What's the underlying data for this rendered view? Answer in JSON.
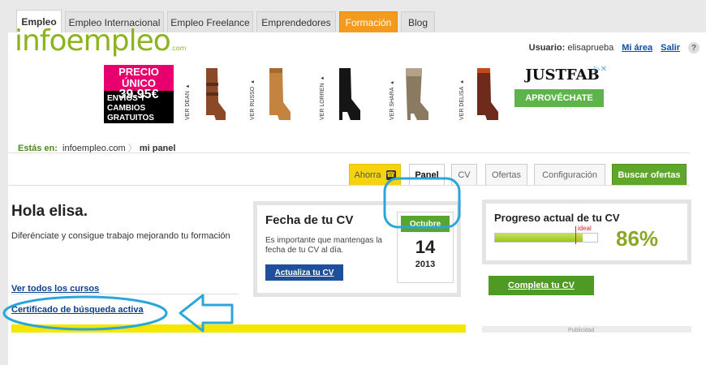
{
  "top_tabs": [
    {
      "label": "Empleo"
    },
    {
      "label": "Empleo Internacional"
    },
    {
      "label": "Empleo Freelance"
    },
    {
      "label": "Emprendedores"
    },
    {
      "label": "Formación"
    },
    {
      "label": "Blog"
    }
  ],
  "logo": {
    "text": "infoempleo",
    "suffix": ".com"
  },
  "user": {
    "label": "Usuario:",
    "name": "elisaprueba",
    "mi_area": "Mi área",
    "salir": "Salir",
    "help": "?"
  },
  "banner": {
    "promo_price_line1": "PRECIO ÚNICO",
    "promo_price_line2": "39.95€",
    "promo_shipping": "ENVÍOS Y CAMBIOS GRATUITOS",
    "boots": [
      "VER DEAN ▸",
      "VER RUSSO ▸",
      "VER LORREN ▸",
      "VER SHARA ▸",
      "VER DELISA ▸"
    ],
    "brand": "JUSTFAB",
    "cta": "APROVÉCHATE",
    "ad_marks": "▷✕"
  },
  "breadcrumb": {
    "label": "Estás en:",
    "home": "infoempleo.com",
    "current": "mi panel"
  },
  "panel_tabs": [
    {
      "label": "Ahorra"
    },
    {
      "label": "Panel"
    },
    {
      "label": "CV"
    },
    {
      "label": "Ofertas"
    },
    {
      "label": "Configuración"
    },
    {
      "label": "Buscar ofertas"
    }
  ],
  "greeting": {
    "title": "Hola elisa.",
    "subtitle": "Diferénciate y consigue trabajo mejorando tu formación",
    "link_courses": "Ver todos los cursos",
    "link_certificate": "Certificado de búsqueda activa"
  },
  "cv_date": {
    "title": "Fecha de tu CV",
    "description": "Es importante que mantengas la fecha de tu CV al día.",
    "button": "Actualiza tu CV",
    "month": "Octubre",
    "day": "14",
    "year": "2013"
  },
  "progress": {
    "title": "Progreso actual de tu CV",
    "percent_label": "86%",
    "value": 0.86,
    "ideal_label": "ideal",
    "ideal_value": 0.78,
    "button": "Completa tu CV"
  },
  "sidebar_ad": {
    "label": "Publicidad"
  },
  "colors": {
    "brand_green": "#8cb320",
    "link_blue": "#0b3f8c",
    "formacion_orange": "#f39a1f",
    "annotation_blue": "#2aa6dc"
  },
  "annotations": {
    "highlight_shapes": [
      "ellipse-around-panel-tab",
      "ellipse-around-certificate-link",
      "left-arrow"
    ]
  }
}
